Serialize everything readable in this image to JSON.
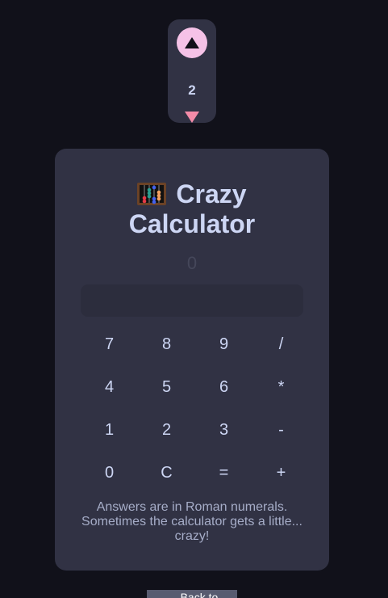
{
  "vote": {
    "up_icon": "triangle-up-icon",
    "count": "2",
    "down_icon": "triangle-down-icon"
  },
  "card": {
    "title_line1": "Crazy",
    "title_line2": "Calculator",
    "title_icon": "abacus-icon",
    "display_value": "0",
    "result_value": "",
    "keys": [
      "7",
      "8",
      "9",
      "/",
      "4",
      "5",
      "6",
      "*",
      "1",
      "2",
      "3",
      "-",
      "0",
      "C",
      "=",
      "+"
    ],
    "note": "Answers are in Roman numerals. Sometimes the calculator gets a little... crazy!"
  },
  "footer": {
    "back_label": "← Back to Gallery"
  },
  "colors": {
    "background": "#11111a",
    "card": "#313244",
    "accent_pink": "#f5c2e7",
    "text": "#cdd6f4"
  }
}
